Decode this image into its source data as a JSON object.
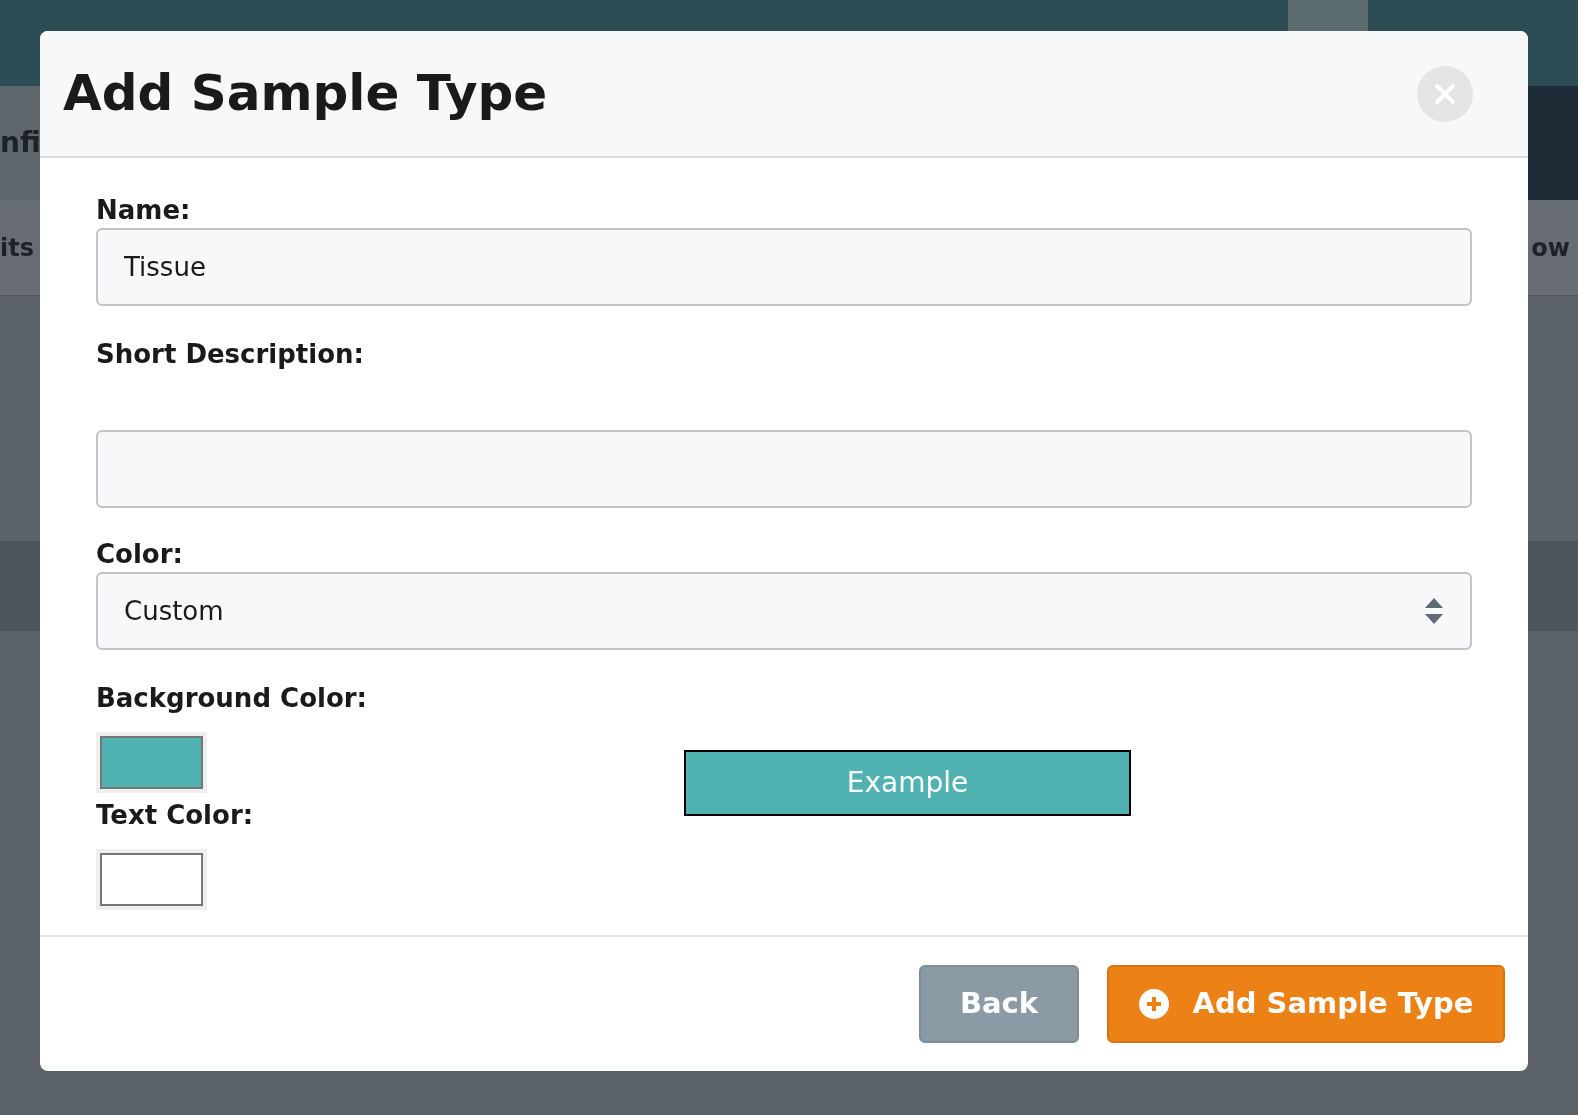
{
  "background_page": {
    "left_texts": [
      "nfi",
      "its"
    ],
    "right_texts": [
      "ow"
    ]
  },
  "dialog": {
    "title": "Add Sample Type",
    "fields": [
      {
        "kind": "text",
        "label": "Name:",
        "value": "Tissue"
      },
      {
        "kind": "textarea",
        "label": "Short Description:"
      },
      {
        "kind": "select",
        "label": "Color:",
        "value": "Custom"
      },
      {
        "kind": "color",
        "label": "Background Color:",
        "color": "#51b3b1"
      },
      {
        "kind": "color",
        "label": "Text Color:",
        "color": "#ffffff"
      }
    ],
    "example": {
      "text": "Example"
    },
    "buttons": [
      {
        "kind": "secondary",
        "label": "Back"
      },
      {
        "kind": "primary",
        "label": "Add Sample Type"
      }
    ]
  }
}
